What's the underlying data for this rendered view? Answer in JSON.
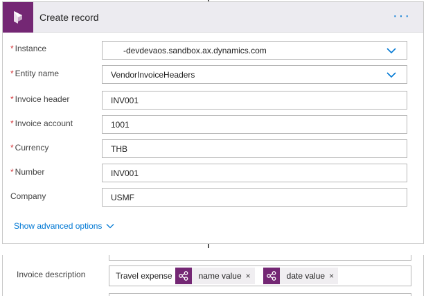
{
  "header": {
    "title": "Create record",
    "more_label": "···",
    "accent": "#742774"
  },
  "fields": [
    {
      "label": "Instance",
      "required": true,
      "value": "-devdevaos.sandbox.ax.dynamics.com",
      "type": "select"
    },
    {
      "label": "Entity name",
      "required": true,
      "value": "VendorInvoiceHeaders",
      "type": "select"
    },
    {
      "label": "Invoice header",
      "required": true,
      "value": "INV001",
      "type": "text"
    },
    {
      "label": "Invoice account",
      "required": true,
      "value": "1001",
      "type": "text"
    },
    {
      "label": "Currency",
      "required": true,
      "value": "THB",
      "type": "text"
    },
    {
      "label": "Number",
      "required": true,
      "value": "INV001",
      "type": "text"
    },
    {
      "label": "Company",
      "required": false,
      "value": "USMF",
      "type": "text"
    }
  ],
  "required_mark": "*",
  "advanced": {
    "label": "Show advanced options"
  },
  "description": {
    "label": "Invoice description",
    "text": "Travel expense",
    "tokens": [
      {
        "label": "name value",
        "remove": "×",
        "icon": "dynamics-icon"
      },
      {
        "label": "date value",
        "remove": "×",
        "icon": "dynamics-icon"
      }
    ]
  }
}
